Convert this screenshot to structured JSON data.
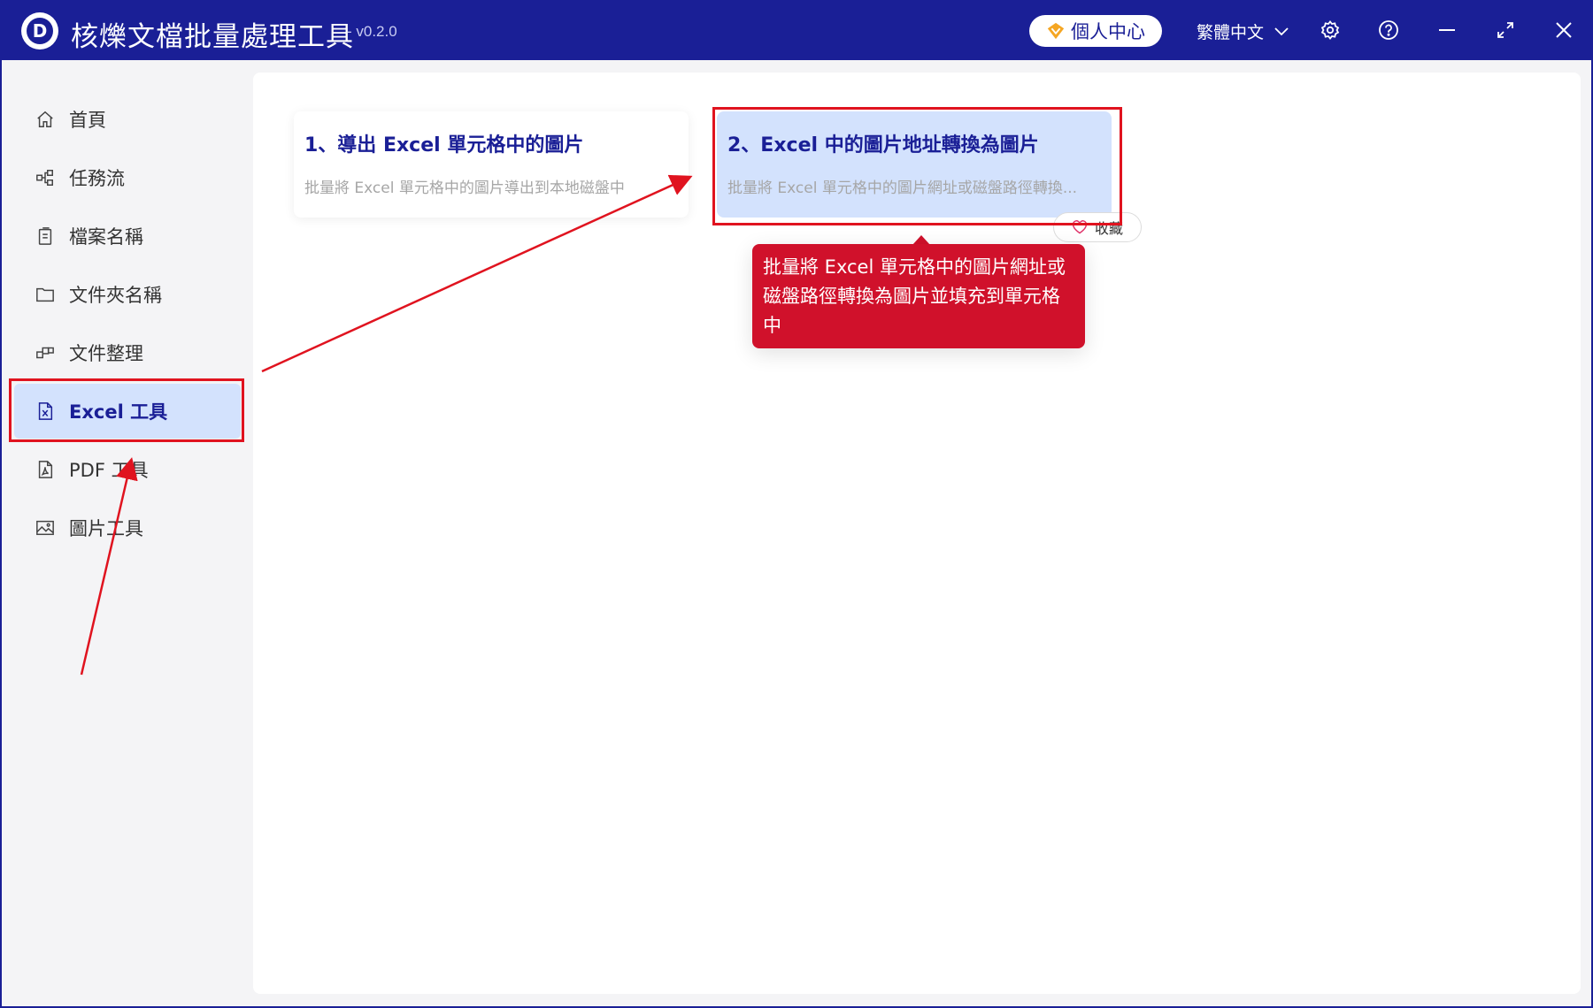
{
  "app": {
    "logo_letter": "D",
    "title": "核爍文檔批量處理工具",
    "version": "- v0.2.0"
  },
  "titlebar": {
    "vip_label": "個人中心",
    "language": "繁體中文",
    "icons": [
      "settings-icon",
      "help-icon",
      "minimize-icon",
      "maximize-icon",
      "close-icon"
    ]
  },
  "sidebar": {
    "items": [
      {
        "label": "首頁",
        "icon": "home-icon"
      },
      {
        "label": "任務流",
        "icon": "workflow-icon"
      },
      {
        "label": "檔案名稱",
        "icon": "file-name-icon"
      },
      {
        "label": "文件夾名稱",
        "icon": "folder-icon"
      },
      {
        "label": "文件整理",
        "icon": "organize-icon"
      },
      {
        "label": "Excel 工具",
        "icon": "excel-file-icon",
        "active": true
      },
      {
        "label": "PDF 工具",
        "icon": "pdf-file-icon"
      },
      {
        "label": "圖片工具",
        "icon": "image-icon"
      }
    ]
  },
  "cards": [
    {
      "title": "1、導出 Excel 單元格中的圖片",
      "desc": "批量將 Excel 單元格中的圖片導出到本地磁盤中"
    },
    {
      "title": "2、Excel 中的圖片地址轉換為圖片",
      "desc": "批量將 Excel 單元格中的圖片網址或磁盤路徑轉換...",
      "highlighted": true
    }
  ],
  "favorite_label": "收藏",
  "tooltip": {
    "line1": "批量將 Excel 單元格中的圖片網址或",
    "line2": "磁盤路徑轉換為圖片並填充到單元格",
    "line3": "中"
  },
  "colors": {
    "brand": "#1a1f96",
    "active_bg": "#d3e2fd",
    "tooltip_bg": "#d0112b",
    "annotation": "#e0131f",
    "vip_icon": "#f5a623"
  }
}
